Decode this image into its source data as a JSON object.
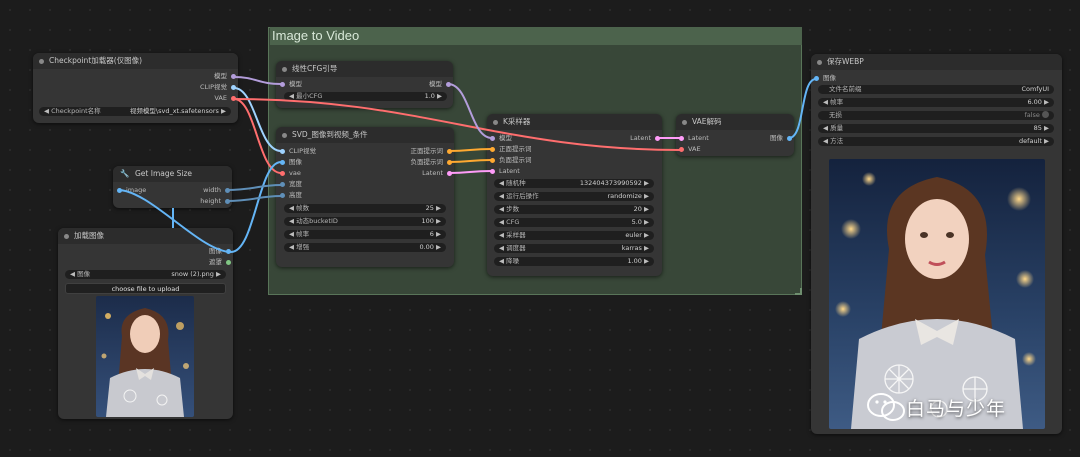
{
  "group": {
    "title": "Image to Video"
  },
  "nodes": {
    "checkpoint": {
      "title": "Checkpoint加载器(仅图像)",
      "outputs": [
        "模型",
        "CLIP视觉",
        "VAE"
      ],
      "widget_label": "Checkpoint名称",
      "widget_value": "视频模型\\svd_xt.safetensors"
    },
    "cfg_guidance": {
      "title": "线性CFG引导",
      "input": "模型",
      "output": "模型",
      "widget_label": "最小CFG",
      "widget_value": "1.0"
    },
    "svd_cond": {
      "title": "SVD_图像到视频_条件",
      "inputs": [
        "CLIP视觉",
        "图像",
        "vae",
        "宽度",
        "高度"
      ],
      "outputs": [
        "正面提示词",
        "负面提示词",
        "Latent"
      ],
      "widgets": [
        {
          "label": "帧数",
          "value": "25"
        },
        {
          "label": "动态bucketID",
          "value": "100"
        },
        {
          "label": "帧率",
          "value": "6"
        },
        {
          "label": "增强",
          "value": "0.00"
        }
      ]
    },
    "get_size": {
      "title": "Get Image Size",
      "input": "image",
      "outputs": [
        "width",
        "height"
      ]
    },
    "load_image": {
      "title": "加载图像",
      "outputs": [
        "图像",
        "遮罩"
      ],
      "widget_label": "图像",
      "widget_value": "snow (2).png",
      "upload_label": "choose file to upload"
    },
    "ksampler": {
      "title": "K采样器",
      "inputs": [
        "模型",
        "正面提示词",
        "负面提示词",
        "Latent"
      ],
      "output": "Latent",
      "widgets": [
        {
          "label": "随机种",
          "value": "132404373990592"
        },
        {
          "label": "运行后操作",
          "value": "randomize"
        },
        {
          "label": "步数",
          "value": "20"
        },
        {
          "label": "CFG",
          "value": "5.0"
        },
        {
          "label": "采样器",
          "value": "euler"
        },
        {
          "label": "调度器",
          "value": "karras"
        },
        {
          "label": "降噪",
          "value": "1.00"
        }
      ]
    },
    "vae_decode": {
      "title": "VAE解码",
      "inputs": [
        "Latent",
        "VAE"
      ],
      "output": "图像"
    },
    "save_webp": {
      "title": "保存WEBP",
      "input": "图像",
      "widgets": [
        {
          "label": "文件名前缀",
          "value": "ComfyUI"
        },
        {
          "label": "帧率",
          "value": "6.00"
        },
        {
          "label": "无损",
          "value": "false"
        },
        {
          "label": "质量",
          "value": "85"
        },
        {
          "label": "方法",
          "value": "default"
        }
      ]
    }
  },
  "watermark": {
    "text": "白马与少年"
  },
  "colors": {
    "model": "#b39ddb",
    "clip_vision": "#9fd3ff",
    "vae": "#ff6e6e",
    "image": "#64b5f6",
    "int": "#5f8fb8",
    "conditioning": "#ffa931",
    "latent": "#ff9cf9",
    "mask": "#81c784",
    "group": "#3a4a3a"
  }
}
